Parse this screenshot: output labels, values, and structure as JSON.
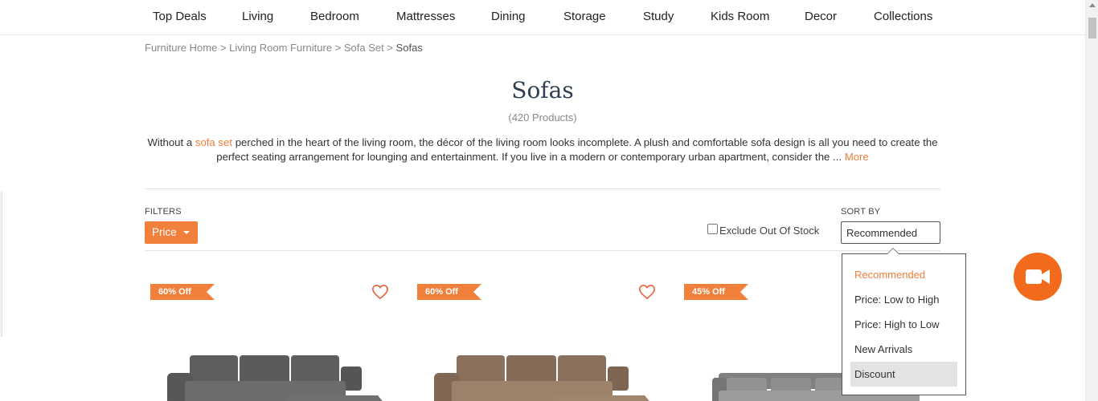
{
  "nav": {
    "items": [
      "Top Deals",
      "Living",
      "Bedroom",
      "Mattresses",
      "Dining",
      "Storage",
      "Study",
      "Kids Room",
      "Decor",
      "Collections"
    ]
  },
  "breadcrumb": {
    "items": [
      "Furniture Home",
      "Living Room Furniture",
      "Sofa Set"
    ],
    "separator": ">",
    "current": "Sofas"
  },
  "page": {
    "title": "Sofas",
    "count": "(420 Products)"
  },
  "description": {
    "prefix": "Without a",
    "link": "sofa set",
    "text": "perched in the heart of the living room, the décor of the living room looks incomplete. A plush and comfortable sofa design is all you need to create the perfect seating arrangement for lounging and entertainment. If you live in a modern or contemporary urban apartment, consider the ...",
    "more": "More"
  },
  "filters": {
    "label": "FILTERS",
    "price_button": "Price",
    "exclude_label": "Exclude Out Of Stock",
    "exclude_checked": false
  },
  "sort": {
    "label": "SORT BY",
    "selected": "Recommended",
    "options": [
      "Recommended",
      "Price: Low to High",
      "Price: High to Low",
      "New Arrivals",
      "Discount"
    ],
    "hovered": "Discount"
  },
  "products": [
    {
      "badge": "60% Off",
      "sofa_color": "#5d5e60"
    },
    {
      "badge": "60% Off",
      "sofa_color": "#8b715c"
    },
    {
      "badge": "45% Off",
      "sofa_color": "#888a8c"
    }
  ],
  "colors": {
    "accent": "#f0803c",
    "video_button": "#f26b1d",
    "title": "#2d3e50"
  },
  "icons": {
    "video": "video-camera-icon",
    "wishlist": "heart-icon",
    "dropdown": "caret-down-icon"
  }
}
